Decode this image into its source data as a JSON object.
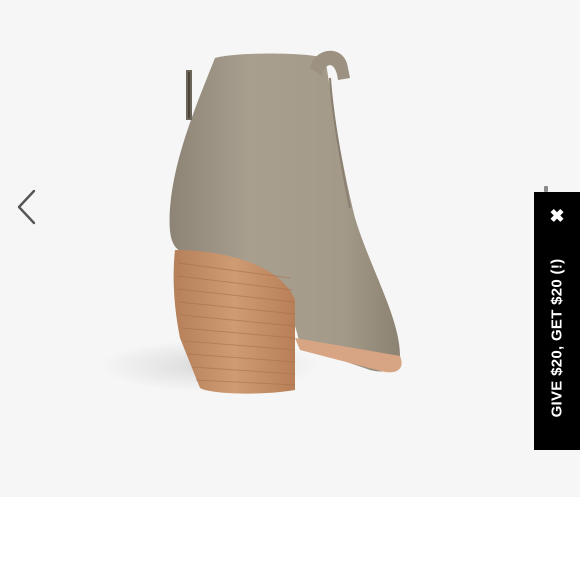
{
  "gallery": {
    "image_alt": "Suede ankle boot with stacked wooden heel, rear view",
    "prev_icon": "chevron-left-icon"
  },
  "promo": {
    "label": "GIVE $20, GET $20 (!)",
    "close_glyph": "✖",
    "background": "#000000",
    "text_color": "#ffffff"
  },
  "colors": {
    "suede": "#a39887",
    "heel_wood": "#c9946a",
    "page_bg": "#f6f6f6"
  }
}
